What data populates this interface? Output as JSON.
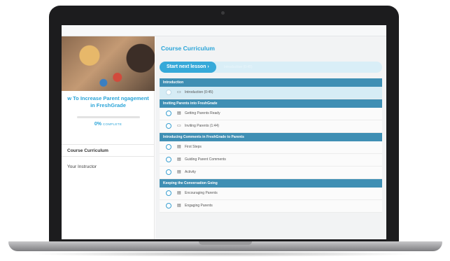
{
  "sidebar": {
    "course_title": "w To Increase Parent ngagement in FreshGrade",
    "progress_percent": 0,
    "progress_label": "0%",
    "complete_label": "COMPLETE",
    "nav": [
      "Course Curriculum",
      "Your Instructor"
    ]
  },
  "main": {
    "title": "Course Curriculum",
    "next_button": "Start next lesson  ›",
    "next_lesson_text": "Introduction (0:45)"
  },
  "curriculum": {
    "sections": [
      {
        "title": "Introduction",
        "lessons": [
          {
            "icon": "video-icon",
            "label": "Introduction (0:45)",
            "current": true
          }
        ]
      },
      {
        "title": "Inviting Parents into FreshGrade",
        "lessons": [
          {
            "icon": "document-icon",
            "label": "Getting Parents Ready"
          },
          {
            "icon": "video-icon",
            "label": "Inviting Parents (1:44)"
          }
        ]
      },
      {
        "title": "Introducing Comments in FreshGrade to Parents",
        "lessons": [
          {
            "icon": "document-icon",
            "label": "First Steps"
          },
          {
            "icon": "document-icon",
            "label": "Guiding Parent Comments"
          },
          {
            "icon": "document-icon",
            "label": "Activity"
          }
        ]
      },
      {
        "title": "Keeping the Conversation Going",
        "lessons": [
          {
            "icon": "document-icon",
            "label": "Encouraging Parents"
          },
          {
            "icon": "document-icon",
            "label": "Engaging Parents"
          }
        ]
      }
    ]
  },
  "colors": {
    "accent": "#2aa4d8",
    "section_bar": "#3f8fb4",
    "laptop_body": "#1c1c1e"
  }
}
